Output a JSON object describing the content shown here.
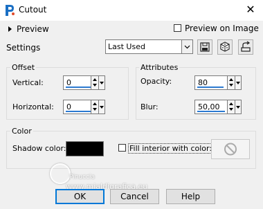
{
  "window": {
    "title": "Cutout"
  },
  "preview": {
    "label": "Preview",
    "preview_on_image_label": "Preview on Image",
    "preview_on_image_checked": false
  },
  "settings": {
    "label": "Settings",
    "preset_value": "Last Used"
  },
  "offset": {
    "group_label": "Offset",
    "vertical": {
      "label": "Vertical:",
      "value": "0"
    },
    "horizontal": {
      "label": "Horizontal:",
      "value": "0"
    }
  },
  "attributes": {
    "group_label": "Attributes",
    "opacity": {
      "label": "Opacity:",
      "value": "80"
    },
    "blur": {
      "label": "Blur:",
      "value": "50,00"
    }
  },
  "color": {
    "group_label": "Color",
    "shadow_color_label": "Shadow color:",
    "shadow_color": "#000000",
    "fill_interior_label": "Fill interior with color:",
    "fill_interior_checked": false
  },
  "buttons": {
    "ok": "OK",
    "cancel": "Cancel",
    "help": "Help"
  },
  "watermark": {
    "line1": "Pinuccia",
    "line2": "www.mialdigrafica.eu"
  },
  "colors": {
    "accent": "#2b79d0",
    "focus": "#0078d7"
  }
}
